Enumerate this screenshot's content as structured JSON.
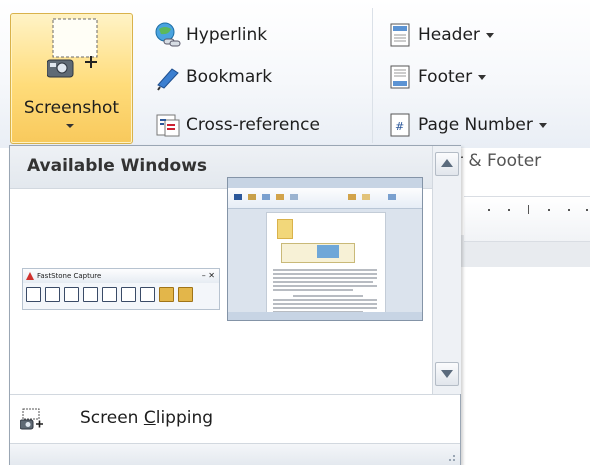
{
  "ribbon": {
    "screenshot": {
      "label": "Screenshot"
    },
    "links": [
      {
        "label": "Hyperlink",
        "icon": "hyperlink-icon"
      },
      {
        "label": "Bookmark",
        "icon": "bookmark-icon"
      },
      {
        "label": "Cross-reference",
        "icon": "cross-reference-icon"
      }
    ],
    "header_footer": [
      {
        "label": "Header",
        "icon": "header-icon"
      },
      {
        "label": "Footer",
        "icon": "footer-icon"
      },
      {
        "label": "Page Number",
        "icon": "page-number-icon"
      }
    ],
    "group_label_partial": "r & Footer"
  },
  "gallery": {
    "title": "Available Windows",
    "windows": [
      {
        "title": "FastStone Capture",
        "controls": "–  ✕"
      },
      {
        "title": ""
      }
    ],
    "clipping": {
      "label_before": "Screen ",
      "label_underlined": "C",
      "label_after": "lipping"
    }
  },
  "colors": {
    "button_highlight": "#ffdc7a",
    "gallery_border": "#9aa6b4",
    "accent_blue": "#2b579a"
  }
}
